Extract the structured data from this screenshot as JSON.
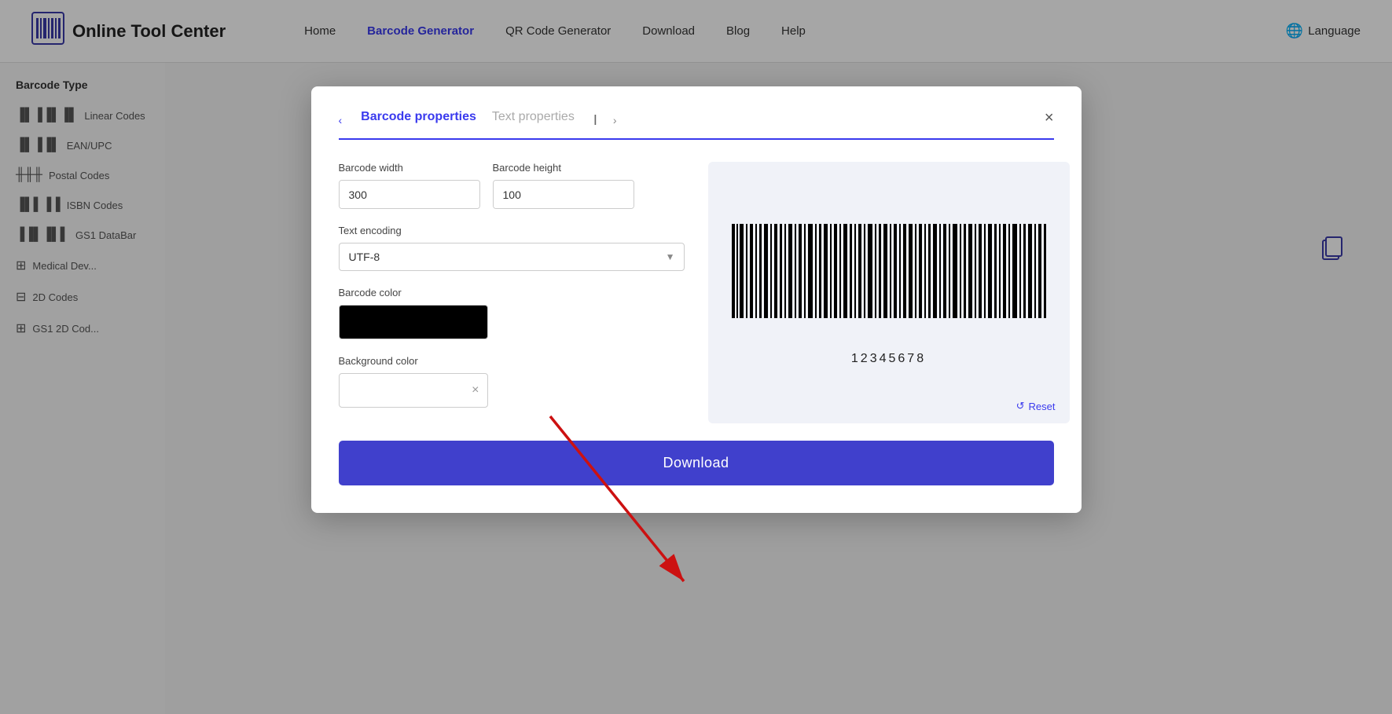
{
  "header": {
    "logo_text": "Online Tool Center",
    "nav": [
      {
        "label": "Home",
        "active": false
      },
      {
        "label": "Barcode Generator",
        "active": true
      },
      {
        "label": "QR Code Generator",
        "active": false
      },
      {
        "label": "Download",
        "active": false
      },
      {
        "label": "Blog",
        "active": false
      },
      {
        "label": "Help",
        "active": false
      }
    ],
    "language_label": "Language"
  },
  "sidebar": {
    "title": "Barcode Type",
    "items": [
      {
        "label": "Linear Codes",
        "icon": "|||"
      },
      {
        "label": "EAN/UPC",
        "icon": "|||"
      },
      {
        "label": "Postal Codes",
        "icon": "|||"
      },
      {
        "label": "ISBN Codes",
        "icon": "|||"
      },
      {
        "label": "GS1 DataBar",
        "icon": "|||"
      },
      {
        "label": "Medical Dev...",
        "icon": "|||"
      },
      {
        "label": "2D Codes",
        "icon": "|||"
      },
      {
        "label": "GS1 2D Cod...",
        "icon": "|||"
      }
    ]
  },
  "modal": {
    "tab_barcode_props": "Barcode properties",
    "tab_text_props": "Text properties",
    "close_label": "×",
    "fields": {
      "barcode_width_label": "Barcode width",
      "barcode_width_value": "300",
      "barcode_height_label": "Barcode height",
      "barcode_height_value": "100",
      "text_encoding_label": "Text encoding",
      "text_encoding_value": "UTF-8",
      "barcode_color_label": "Barcode color",
      "background_color_label": "Background color"
    },
    "barcode_value": "12345678",
    "reset_label": "Reset",
    "download_label": "Download"
  }
}
